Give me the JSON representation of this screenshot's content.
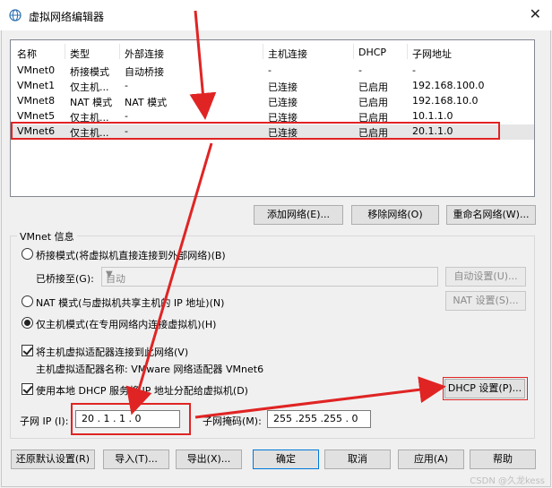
{
  "window": {
    "title": "虚拟网络编辑器",
    "close_glyph": "✕"
  },
  "table": {
    "headers": [
      "名称",
      "类型",
      "外部连接",
      "主机连接",
      "DHCP",
      "子网地址"
    ],
    "rows": [
      [
        "VMnet0",
        "桥接模式",
        "自动桥接",
        "-",
        "-",
        "-"
      ],
      [
        "VMnet1",
        "仅主机...",
        "-",
        "已连接",
        "已启用",
        "192.168.100.0"
      ],
      [
        "VMnet8",
        "NAT 模式",
        "NAT 模式",
        "已连接",
        "已启用",
        "192.168.10.0"
      ],
      [
        "VMnet5",
        "仅主机...",
        "-",
        "已连接",
        "已启用",
        "10.1.1.0"
      ],
      [
        "VMnet6",
        "仅主机...",
        "-",
        "已连接",
        "已启用",
        "20.1.1.0"
      ]
    ],
    "selected_row": 4
  },
  "table_buttons": {
    "add": "添加网络(E)...",
    "remove": "移除网络(O)",
    "rename": "重命名网络(W)..."
  },
  "vmnet_info": {
    "group_title": "VMnet 信息",
    "bridge_radio": "桥接模式(将虚拟机直接连接到外部网络)(B)",
    "bridged_to_label": "已桥接至(G):",
    "bridged_to_value": "自动",
    "auto_settings": "自动设置(U)...",
    "nat_radio": "NAT 模式(与虚拟机共享主机的 IP 地址)(N)",
    "nat_settings": "NAT 设置(S)...",
    "hostonly_radio": "仅主机模式(在专用网络内连接虚拟机)(H)",
    "selected_mode": "hostonly",
    "connect_adapter_check": "将主机虚拟适配器连接到此网络(V)",
    "adapter_name_line": "主机虚拟适配器名称: VMware 网络适配器 VMnet6",
    "dhcp_check": "使用本地 DHCP 服务将 IP 地址分配给虚拟机(D)",
    "dhcp_settings": "DHCP 设置(P)...",
    "subnet_ip_label": "子网 IP (I):",
    "subnet_ip_value": "20 . 1 . 1 . 0",
    "subnet_mask_label": "子网掩码(M):",
    "subnet_mask_value": "255 .255 .255 . 0"
  },
  "footer_buttons": {
    "restore": "还原默认设置(R)",
    "import": "导入(T)...",
    "export": "导出(X)...",
    "ok": "确定",
    "cancel": "取消",
    "apply": "应用(A)",
    "help": "帮助"
  },
  "watermark": "CSDN @久龙kess",
  "colors": {
    "annotation_red": "#e02424",
    "selected_row": "#e6e6e6",
    "primary_border": "#0078d7"
  }
}
